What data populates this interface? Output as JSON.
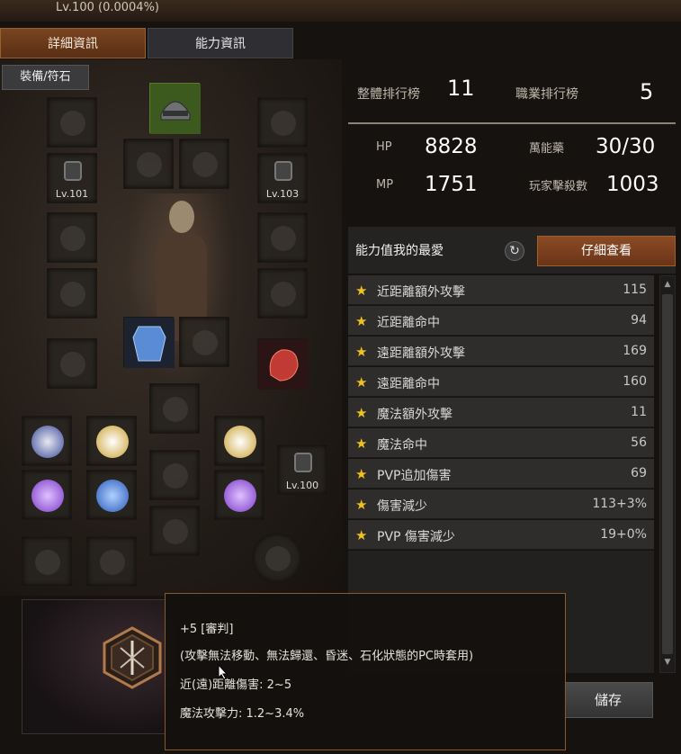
{
  "header": {
    "level_text": "Lv.100 (0.0004%)"
  },
  "tabs": [
    {
      "label": "詳細資訊",
      "active": true
    },
    {
      "label": "能力資訊",
      "active": false
    }
  ],
  "equipment": {
    "label": "裝備/符石",
    "slot_levels": {
      "earring_left": "Lv.101",
      "earring_right": "Lv.103",
      "extra": "Lv.100"
    }
  },
  "rankings": {
    "overall_label": "整體排行榜",
    "overall_value": "11",
    "class_label": "職業排行榜",
    "class_value": "5"
  },
  "stats": {
    "hp_label": "HP",
    "hp_value": "8828",
    "mp_label": "MP",
    "mp_value": "1751",
    "potion_label": "萬能藥",
    "potion_value": "30/30",
    "pvp_kills_label": "玩家擊殺數",
    "pvp_kills_value": "1003"
  },
  "favorites": {
    "title": "能力值我的最愛",
    "detail_button": "仔細查看",
    "items": [
      {
        "name": "近距離額外攻擊",
        "value": "115"
      },
      {
        "name": "近距離命中",
        "value": "94"
      },
      {
        "name": "遠距離額外攻擊",
        "value": "169"
      },
      {
        "name": "遠距離命中",
        "value": "160"
      },
      {
        "name": "魔法額外攻擊",
        "value": "11"
      },
      {
        "name": "魔法命中",
        "value": "56"
      },
      {
        "name": "PVP追加傷害",
        "value": "69"
      },
      {
        "name": "傷害減少",
        "value": "113+3%"
      },
      {
        "name": "PVP 傷害減少",
        "value": "19+0%"
      }
    ]
  },
  "save_button": "儲存",
  "tooltip": {
    "line1": "+5 [審判]",
    "line2": "(攻擊無法移動、無法歸還、昏迷、石化狀態的PC時套用)",
    "line3": "近(遠)距離傷害: 2~5",
    "line4": "魔法攻擊力: 1.2~3.4%"
  },
  "colors": {
    "accent": "#8a4b24",
    "star": "#f2c21a"
  }
}
